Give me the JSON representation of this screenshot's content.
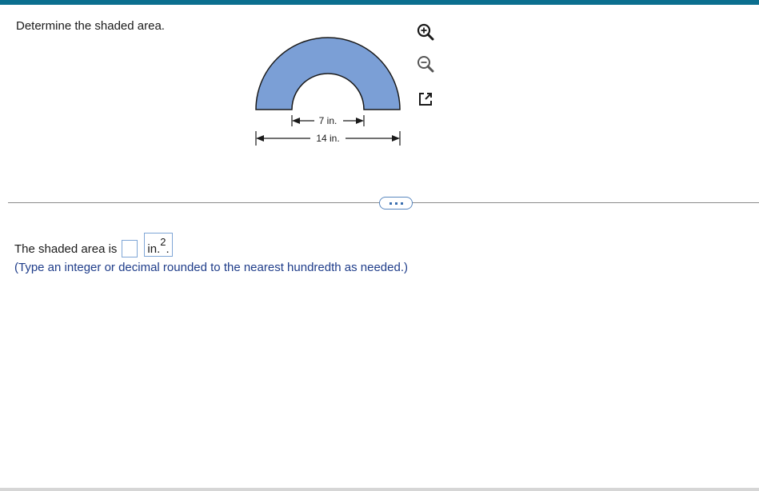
{
  "question": {
    "prompt": "Determine the shaded area."
  },
  "figure": {
    "inner_label": "7 in.",
    "outer_label": "14 in.",
    "shade_color": "#7b9fd6"
  },
  "tools": {
    "zoom_in": "zoom-in-icon",
    "zoom_out": "zoom-out-icon",
    "popout": "popout-icon"
  },
  "answer": {
    "prefix": "The shaded area is",
    "value": "",
    "unit": "in.",
    "unit_exp": "2",
    "suffix": ".",
    "hint": "(Type an integer or decimal rounded to the nearest hundredth as needed.)"
  }
}
